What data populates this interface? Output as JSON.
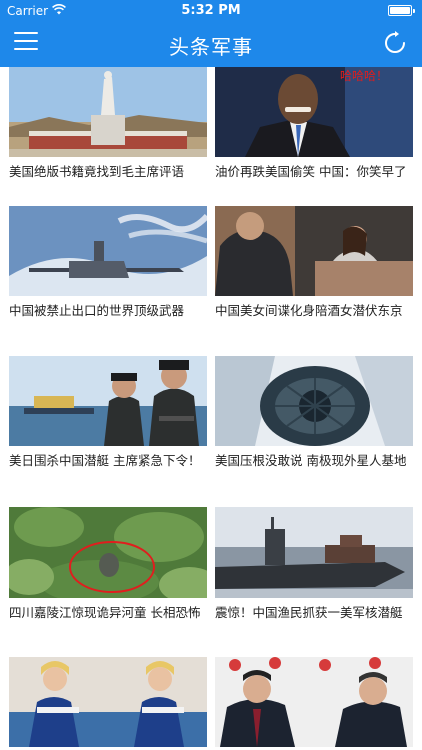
{
  "status_bar": {
    "carrier": "Carrier",
    "time": "5:32 PM"
  },
  "nav": {
    "title": "头条军事"
  },
  "colors": {
    "accent": "#1E88EA"
  },
  "icons": {
    "menu": "hamburger-menu-icon",
    "refresh": "refresh-icon"
  },
  "articles": [
    {
      "caption": "美国绝版书籍竟找到毛主席评语"
    },
    {
      "caption": "油价再跌美国偷笑 中国：你笑早了",
      "overlay_text": "哈哈哈！"
    },
    {
      "caption": "中国被禁止出口的世界顶级武器"
    },
    {
      "caption": "中国美女间谍化身陪酒女潜伏东京"
    },
    {
      "caption": "美日围杀中国潜艇 主席紧急下令！"
    },
    {
      "caption": "美国压根没敢说 南极现外星人基地"
    },
    {
      "caption": "四川嘉陵江惊现诡异河童 长相恐怖"
    },
    {
      "caption": "震惊！中国渔民抓获一美军核潜艇"
    },
    {
      "caption": ""
    },
    {
      "caption": ""
    }
  ]
}
